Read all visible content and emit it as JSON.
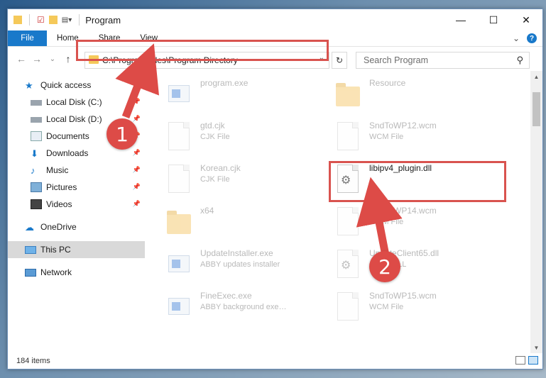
{
  "titlebar": {
    "title": "Program",
    "controls": {
      "minimize": "—",
      "maximize": "☐",
      "close": "✕"
    }
  },
  "ribbon": {
    "tabs": [
      {
        "label": "File"
      },
      {
        "label": "Home"
      },
      {
        "label": "Share"
      },
      {
        "label": "View"
      }
    ],
    "expand_glyph": "⌄",
    "help_glyph": "?"
  },
  "nav": {
    "back": "←",
    "forward": "→",
    "recent": "⌄",
    "up": "↑",
    "address": "C:\\Program Files\\Program Directory",
    "search_placeholder": "Search Program"
  },
  "sidebar": {
    "items": [
      {
        "label": "Quick access",
        "icon": "star-icon",
        "pinned": false
      },
      {
        "label": "Local Disk (C:)",
        "icon": "drive-icon",
        "pinned": true
      },
      {
        "label": "Local Disk (D:)",
        "icon": "drive-icon",
        "pinned": true
      },
      {
        "label": "Documents",
        "icon": "documents-icon",
        "pinned": true
      },
      {
        "label": "Downloads",
        "icon": "downloads-icon",
        "pinned": true
      },
      {
        "label": "Music",
        "icon": "music-icon",
        "pinned": true
      },
      {
        "label": "Pictures",
        "icon": "pictures-icon",
        "pinned": true
      },
      {
        "label": "Videos",
        "icon": "videos-icon",
        "pinned": true
      },
      {
        "label": "OneDrive",
        "icon": "onedrive-icon",
        "pinned": false
      },
      {
        "label": "This PC",
        "icon": "computer-icon",
        "pinned": false,
        "selected": true
      },
      {
        "label": "Network",
        "icon": "network-icon",
        "pinned": false
      }
    ]
  },
  "files": [
    {
      "name": "program.exe",
      "type": "",
      "icon": "program-icon"
    },
    {
      "name": "Resource",
      "type": "",
      "icon": "folder-icon"
    },
    {
      "name": "gtd.cjk",
      "type": "CJK File",
      "icon": "document-icon"
    },
    {
      "name": "SndToWP12.wcm",
      "type": "WCM File",
      "icon": "document-icon"
    },
    {
      "name": "Korean.cjk",
      "type": "CJK File",
      "icon": "document-icon"
    },
    {
      "name": "libipv4_plugin.dll",
      "type": "",
      "icon": "dll-gear-icon"
    },
    {
      "name": "x64",
      "type": "",
      "icon": "folder-icon"
    },
    {
      "name": "SndToWP14.wcm",
      "type": "WCM File",
      "icon": "document-icon"
    },
    {
      "name": "UpdateInstaller.exe",
      "type": "ABBY updates installer",
      "icon": "exe-icon"
    },
    {
      "name": "UpdateClient65.dll",
      "type": "ABBY DLL",
      "icon": "dll-gear-icon"
    },
    {
      "name": "FineExec.exe",
      "type": "ABBY background exe…",
      "icon": "exe-icon"
    },
    {
      "name": "SndToWP15.wcm",
      "type": "WCM File",
      "icon": "document-icon"
    }
  ],
  "annotations": {
    "step1": "1",
    "step2": "2",
    "color": "#dd4b47"
  },
  "status": {
    "items_count": "184 items"
  },
  "colors": {
    "accent": "#1979ca",
    "highlight": "#d9534f"
  }
}
